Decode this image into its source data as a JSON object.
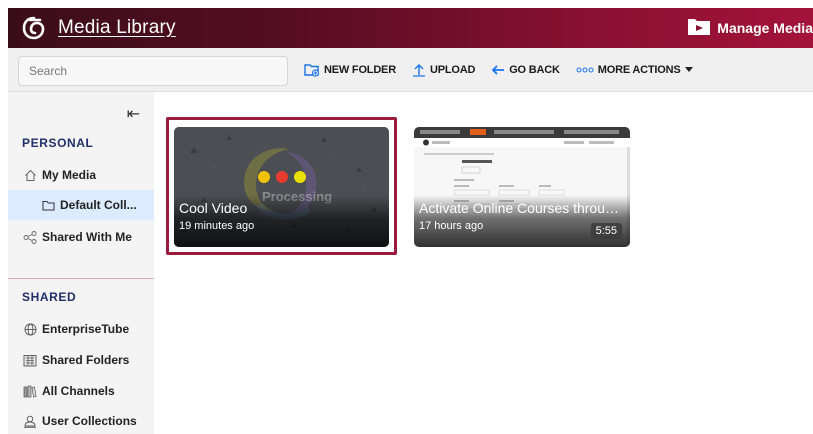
{
  "header": {
    "title": "Media Library",
    "manage_label": "Manage Media",
    "logo_icon": "kaltura-logo-icon",
    "brand_gradient": [
      "#3a0d1a",
      "#a4133a"
    ]
  },
  "toolbar": {
    "search_placeholder": "Search",
    "actions": {
      "new_folder": "NEW FOLDER",
      "upload": "UPLOAD",
      "go_back": "GO BACK",
      "more_actions": "MORE ACTIONS"
    }
  },
  "sidebar": {
    "collapse_glyph": "⇤",
    "personal": {
      "title": "PERSONAL",
      "items": [
        {
          "label": "My Media",
          "icon": "home-icon"
        },
        {
          "label": "Default Coll...",
          "icon": "folder-icon"
        },
        {
          "label": "Shared With Me",
          "icon": "share-icon"
        }
      ]
    },
    "shared": {
      "title": "SHARED",
      "items": [
        {
          "label": "EnterpriseTube",
          "icon": "globe-icon"
        },
        {
          "label": "Shared Folders",
          "icon": "shared-folders-icon"
        },
        {
          "label": "All Channels",
          "icon": "channels-icon"
        },
        {
          "label": "User Collections",
          "icon": "user-collections-icon"
        }
      ]
    }
  },
  "media": [
    {
      "title": "Cool Video",
      "meta": "19 minutes ago",
      "status_text": "Processing",
      "selected": true
    },
    {
      "title": "Activate Online Courses throug...",
      "meta": "17 hours ago",
      "duration": "5:55",
      "selected": false
    }
  ],
  "colors": {
    "accent": "#9a1a3e",
    "section_title": "#1f2f6b",
    "selected_item_bg": "#dcebff",
    "action_blue": "#1a73e8"
  }
}
